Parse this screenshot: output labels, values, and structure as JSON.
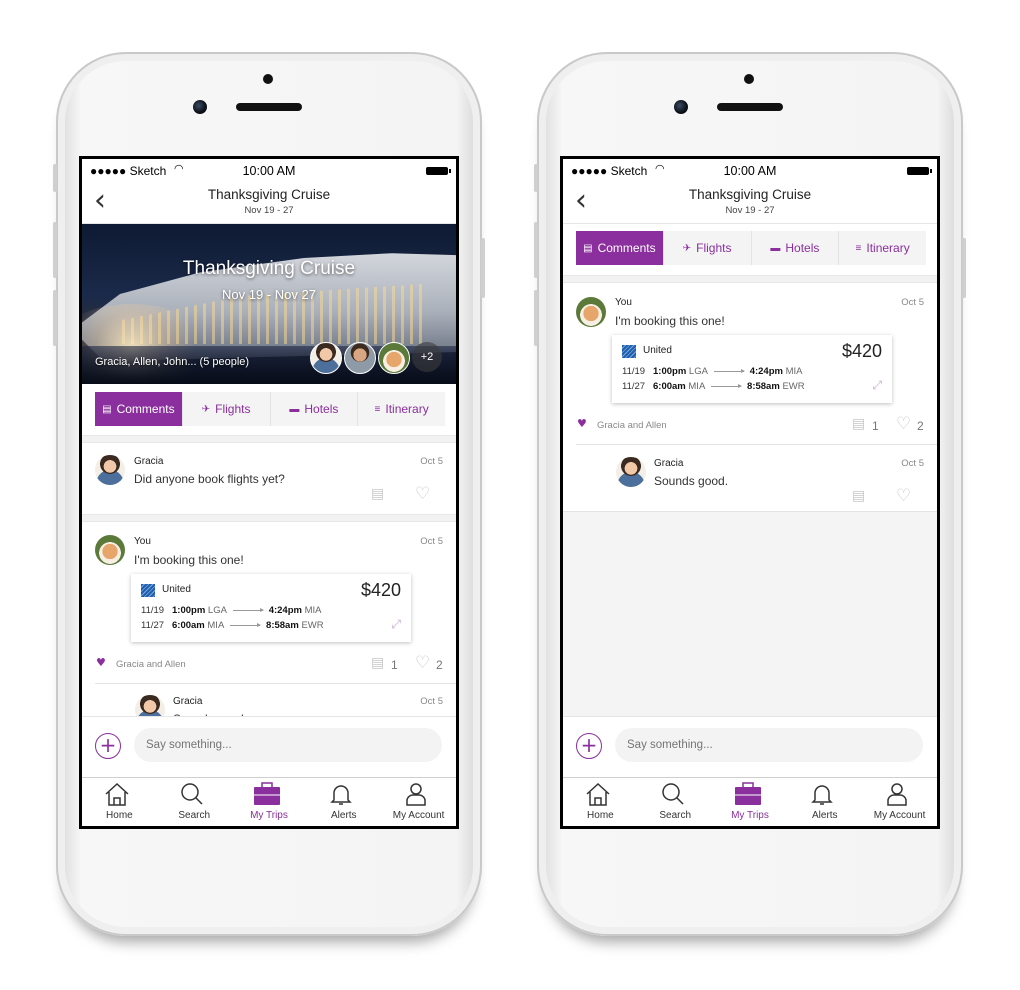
{
  "status": {
    "carrier": "●●●●● Sketch",
    "time": "10:00 AM"
  },
  "trip": {
    "title": "Thanksgiving Cruise",
    "subtitle": "Nov 19 - 27",
    "hero_dates": "Nov 19 - Nov 27",
    "people": "Gracia, Allen, John... (5 people)",
    "more_count": "+2"
  },
  "tabs": [
    {
      "label": "Comments",
      "icon": "comment-icon"
    },
    {
      "label": "Flights",
      "icon": "plane-icon"
    },
    {
      "label": "Hotels",
      "icon": "bed-icon"
    },
    {
      "label": "Itinerary",
      "icon": "list-icon"
    }
  ],
  "comments": {
    "gracia_first": {
      "name": "Gracia",
      "date": "Oct 5",
      "text": "Did anyone book flights yet?"
    },
    "you": {
      "name": "You",
      "date": "Oct 5",
      "text": "I'm booking this one!",
      "likes": "Gracia and Allen",
      "reply_count": "1",
      "like_count": "2"
    },
    "gracia_reply": {
      "name": "Gracia",
      "date": "Oct 5",
      "text": "Sounds good."
    }
  },
  "flight": {
    "airline": "United",
    "price": "$420",
    "legs": [
      {
        "date": "11/19",
        "dep_time": "1:00pm",
        "dep_airport": "LGA",
        "arr_time": "4:24pm",
        "arr_airport": "MIA"
      },
      {
        "date": "11/27",
        "dep_time": "6:00am",
        "dep_airport": "MIA",
        "arr_time": "8:58am",
        "arr_airport": "EWR"
      }
    ]
  },
  "composer": {
    "placeholder": "Say something..."
  },
  "tabbar": [
    {
      "label": "Home"
    },
    {
      "label": "Search"
    },
    {
      "label": "My Trips"
    },
    {
      "label": "Alerts"
    },
    {
      "label": "My Account"
    }
  ],
  "colors": {
    "accent": "#8a2f9d",
    "airline_blue": "#1f5fae"
  }
}
